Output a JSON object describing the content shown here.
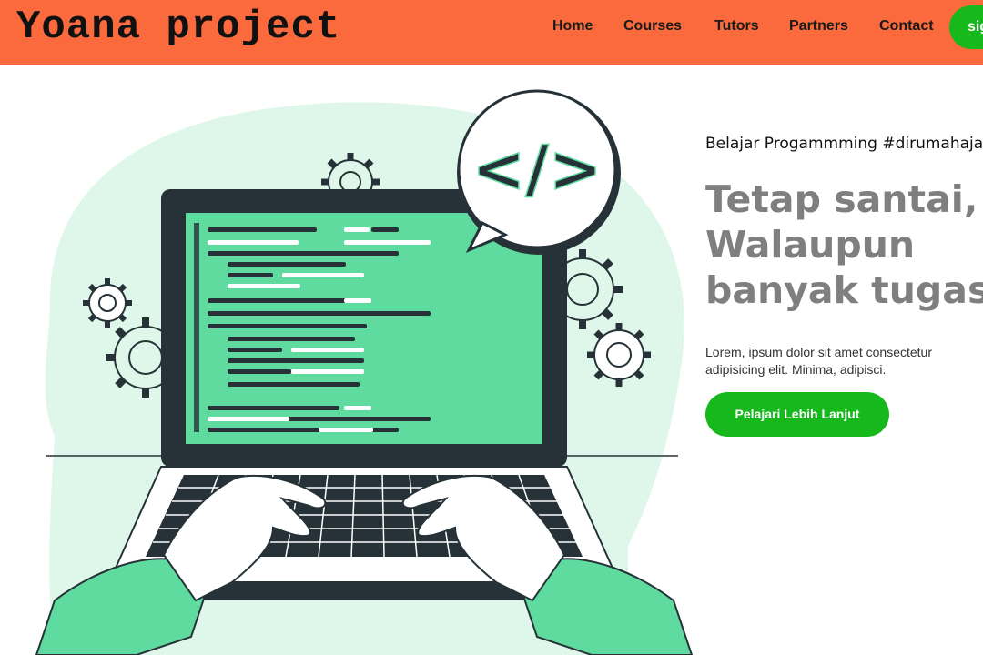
{
  "brand": {
    "logo": "Yoana project"
  },
  "nav": {
    "items": [
      {
        "label": "Home"
      },
      {
        "label": "Courses"
      },
      {
        "label": "Tutors"
      },
      {
        "label": "Partners"
      },
      {
        "label": "Contact"
      }
    ],
    "signup_label": "sign up"
  },
  "hero": {
    "tagline": "Belajar Progammming #dirumahaja",
    "headline_lines": [
      "Tetap santai,",
      "Walaupun",
      "banyak tugas"
    ],
    "description": "Lorem, ipsum dolor sit amet consectetur adipisicing elit. Minima, adipisci.",
    "cta_label": "Pelajari Lebih Lanjut",
    "illustration": {
      "code_symbol": "</>",
      "icons": [
        "laptop-icon",
        "code-bubble-icon",
        "gear-icon"
      ]
    }
  },
  "colors": {
    "navbar": "#fa6a3c",
    "button": "#16b81c",
    "illustration_green": "#5fdba0",
    "illustration_light": "#dff7ea",
    "screen_frame": "#263238",
    "headline": "#7f7f7f"
  }
}
